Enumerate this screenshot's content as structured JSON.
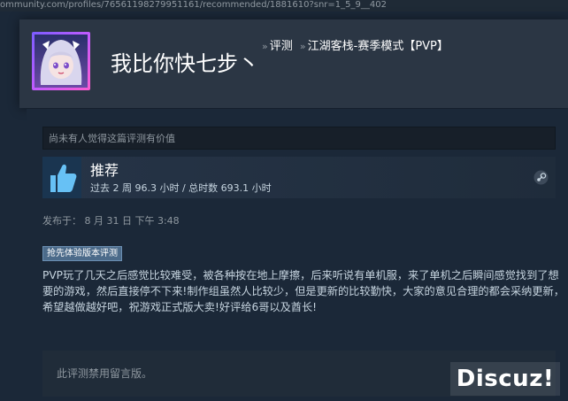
{
  "browser": {
    "url": "ommunity.com/profiles/76561198279951161/recommended/1881610?snr=1_5_9__402"
  },
  "header": {
    "username": "我比你快七步丶",
    "breadcrumb_sep": "»",
    "crumb_reviews": "评测",
    "crumb_game": "江湖客栈-赛季模式【PVP】"
  },
  "review": {
    "helpful_text": "尚未有人觉得这篇评测有价值",
    "verdict": "推荐",
    "hours": "过去 2 周 96.3 小时 / 总时数 693.1 小时",
    "posted": "发布于：  8 月 31 日 下午 3:48",
    "early_access_badge": "抢先体验版本评测",
    "body": "PVP玩了几天之后感觉比较难受，被各种按在地上摩擦，后来听说有单机服，来了单机之后瞬间感觉找到了想要的游戏，然后直接停不下来!制作组虽然人比较少，但是更新的比较勤快，大家的意见合理的都会采纳更新，希望越做越好吧，祝游戏正式版大卖!好评给6哥以及酋长!",
    "comments_disabled": "此评测禁用留言版。"
  },
  "watermark": "Discuz!",
  "icons": {
    "thumb": "thumbs-up-icon",
    "platform": "steam-icon"
  },
  "colors": {
    "background": "#1b2838",
    "header": "#2b3644",
    "badge": "#4c6b8a",
    "thumb": "#67c1f5"
  }
}
